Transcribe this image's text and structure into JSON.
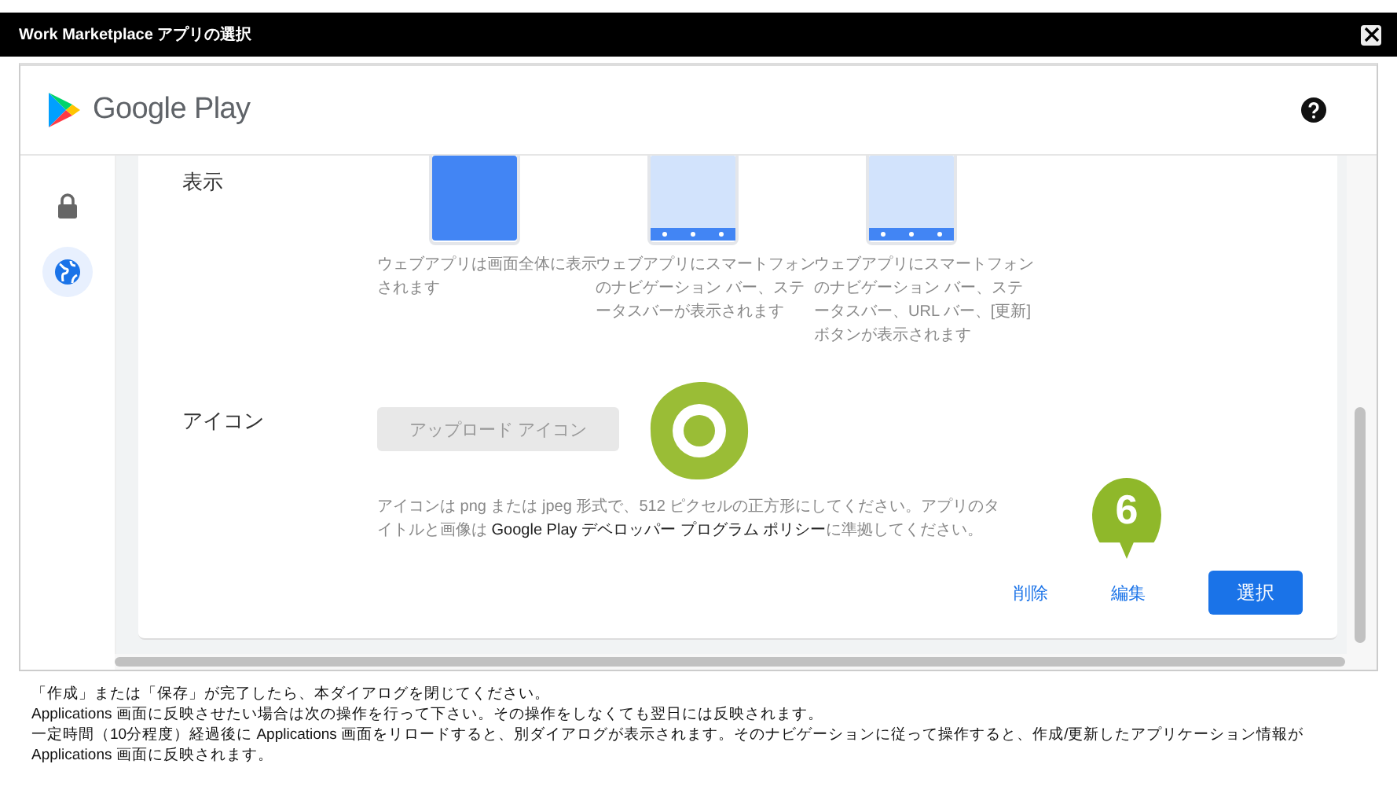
{
  "window": {
    "title": "Work Marketplace アプリの選択"
  },
  "store": {
    "name": "Google Play"
  },
  "rail": [
    {
      "kind": "lock",
      "selected": false
    },
    {
      "kind": "globe",
      "selected": true
    }
  ],
  "display": {
    "label": "表示",
    "options": [
      {
        "kind": "fullscreen",
        "description": "ウェブアプリは画面全体に表示されます"
      },
      {
        "kind": "standalone",
        "description": "ウェブアプリにスマートフォンのナビゲーション バー、ステータスバーが表示されます"
      },
      {
        "kind": "minimal-ui",
        "description": "ウェブアプリにスマートフォンのナビゲーション バー、ステータスバー、URL バー、[更新] ボタンが表示されます"
      }
    ]
  },
  "icon": {
    "label": "アイコン",
    "upload_button": "アップロード アイコン",
    "upload_disabled": true,
    "note": "アイコンは png または jpeg 形式で、512 ピクセルの正方形にしてください。アプリのタイトルと画像は **Google Play デベロッパー プログラム ポリシー**に準拠してください。"
  },
  "actions": {
    "delete": "削除",
    "edit": "編集",
    "select": "選択"
  },
  "callout": {
    "number": "6"
  },
  "footer": [
    "「作成」または「保存」が完了したら、本ダイアログを閉じてください。",
    "Applications 画面に反映させたい場合は次の操作を行って下さい。その操作をしなくても翌日には反映されます。",
    "一定時間（10分程度）経過後に Applications 画面をリロードすると、別ダイアログが表示されます。そのナビゲーションに従って操作すると、作成/更新したアプリケーション情報が Applications 画面に反映されます。"
  ]
}
